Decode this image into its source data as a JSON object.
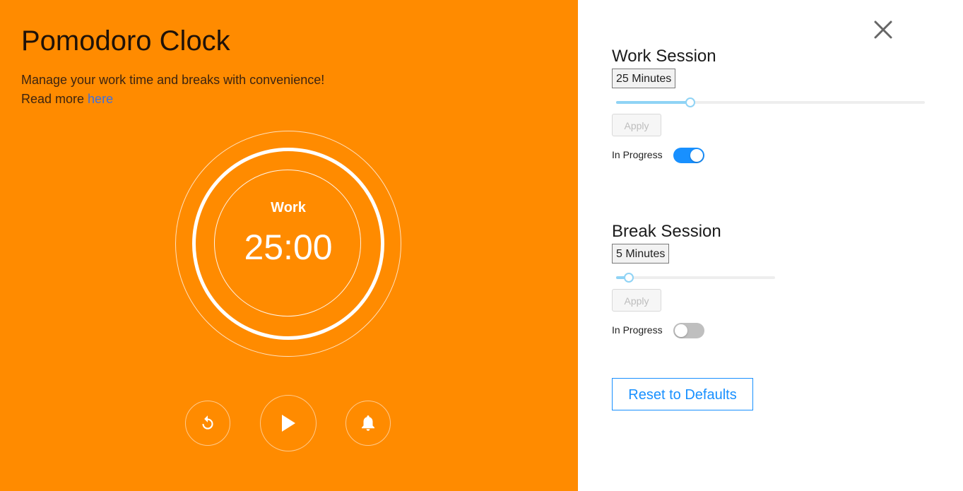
{
  "app": {
    "title": "Pomodoro Clock",
    "description": "Manage your work time and breaks with convenience!",
    "read_more_prefix": "Read more ",
    "read_more_link": "here"
  },
  "timer": {
    "mode": "Work",
    "time": "25:00"
  },
  "controls": {
    "reset_icon": "reset-icon",
    "play_icon": "play-icon",
    "bell_icon": "bell-icon"
  },
  "settings": {
    "close_icon": "close-icon",
    "work": {
      "title": "Work Session",
      "minutes_label": "25 Minutes",
      "slider_fraction": 0.24,
      "apply_label": "Apply",
      "progress_label": "In Progress",
      "in_progress": true
    },
    "break": {
      "title": "Break Session",
      "minutes_label": "5 Minutes",
      "slider_fraction": 0.08,
      "apply_label": "Apply",
      "progress_label": "In Progress",
      "in_progress": false
    },
    "reset_label": "Reset to Defaults"
  },
  "colors": {
    "background_left": "#ff8b00",
    "accent": "#1890ff",
    "slider": "#8fd3f5"
  }
}
